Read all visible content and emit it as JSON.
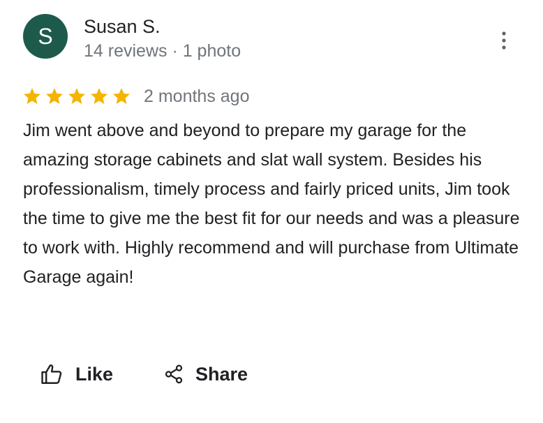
{
  "review": {
    "author": {
      "initial": "S",
      "name": "Susan S.",
      "meta": "14 reviews · 1 photo",
      "avatar_color": "#1e5a4b"
    },
    "rating": 5,
    "rating_max": 5,
    "star_color": "#f4b400",
    "time": "2 months ago",
    "text": "Jim went above and beyond to prepare my garage for the amazing storage cabinets and slat wall system. Besides his professionalism, timely process and fairly priced units, Jim took the time to give me the best fit for our needs and was a pleasure to work with. Highly recommend and will purchase from Ultimate Garage again!"
  },
  "actions": {
    "like_label": "Like",
    "share_label": "Share"
  },
  "icons": {
    "more": "more-vert-icon",
    "like": "thumbs-up-icon",
    "share": "share-icon",
    "star": "star-icon"
  }
}
